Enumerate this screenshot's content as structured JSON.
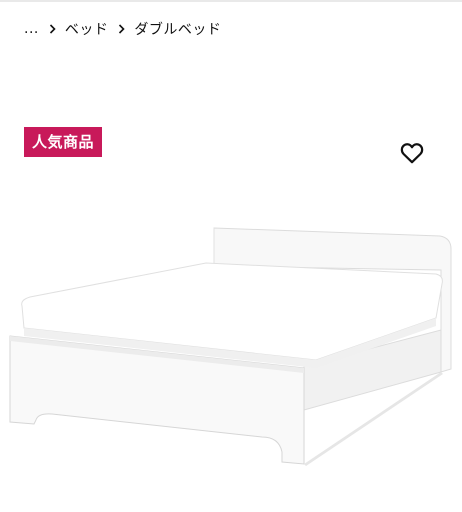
{
  "breadcrumb": {
    "items": [
      "...",
      "ベッド",
      "ダブルベッド"
    ]
  },
  "badge": {
    "label": "人気商品",
    "color": "#c8195a"
  },
  "favorite": {
    "icon": "heart-outline-icon"
  },
  "product": {
    "image_subject": "white double bed frame with mattress",
    "colors": {
      "frame": "#f7f7f7",
      "shadow": "#d4d4d4"
    }
  }
}
